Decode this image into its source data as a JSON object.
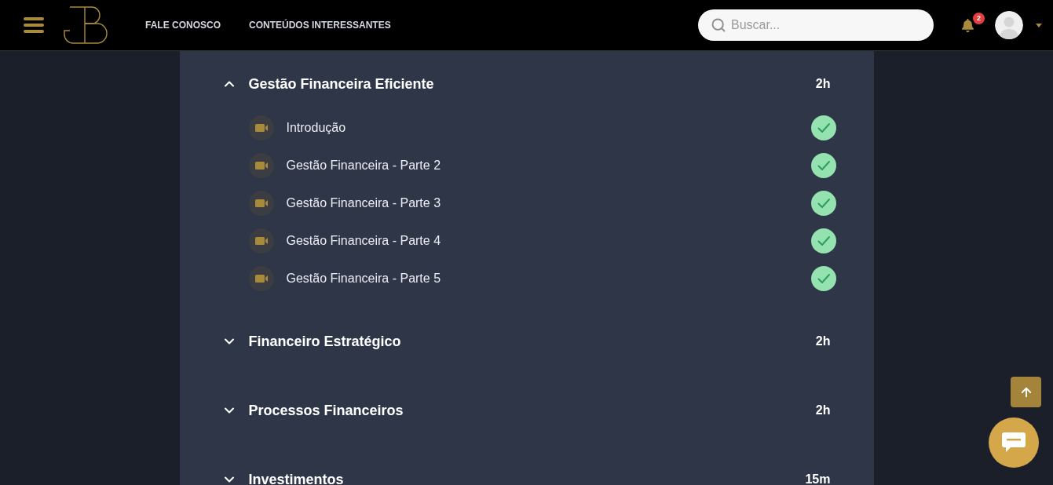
{
  "header": {
    "nav_links": [
      "FALE CONOSCO",
      "CONTEÚDOS INTERESSANTES"
    ],
    "search": {
      "placeholder": "Buscar..."
    },
    "notifications": {
      "count": "2"
    }
  },
  "modules": [
    {
      "title": "Gestão Financeira Eficiente",
      "duration": "2h",
      "expanded": true,
      "lessons": [
        {
          "title": "Introdução",
          "completed": true
        },
        {
          "title": "Gestão Financeira - Parte 2",
          "completed": true
        },
        {
          "title": "Gestão Financeira - Parte 3",
          "completed": true
        },
        {
          "title": "Gestão Financeira - Parte 4",
          "completed": true
        },
        {
          "title": "Gestão Financeira - Parte 5",
          "completed": true
        }
      ]
    },
    {
      "title": "Financeiro Estratégico",
      "duration": "2h",
      "expanded": false
    },
    {
      "title": "Processos Financeiros",
      "duration": "2h",
      "expanded": false
    },
    {
      "title": "Investimentos",
      "duration": "15m",
      "expanded": false
    }
  ]
}
